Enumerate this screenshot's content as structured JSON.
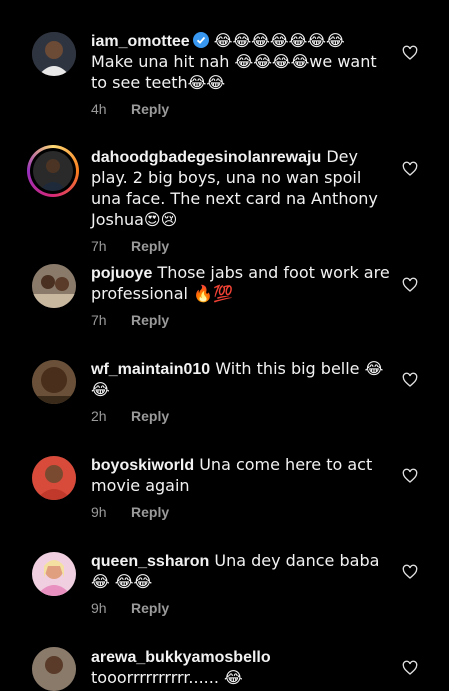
{
  "comments": [
    {
      "user": "iam_omottee",
      "verified": true,
      "text": " 😂😂😂😂😂😂😂 Make una hit nah 😂😂😂😂we want to see teeth😂😂",
      "time": "4h",
      "reply": "Reply",
      "avatar_color": "#4a4a4a"
    },
    {
      "user": "dahoodgbadegesinolanrewaju",
      "verified": false,
      "text": " Dey play. 2 big boys, una no wan spoil una face. The next card na Anthony Joshua😍😢",
      "time": "7h",
      "reply": "Reply",
      "avatar_color": "#3c3c3c"
    },
    {
      "user": "pojuoye",
      "verified": false,
      "text": " Those  jabs and foot work are professional 🔥💯",
      "time": "7h",
      "reply": "Reply",
      "avatar_color": "#6b5a4a"
    },
    {
      "user": "wf_maintain010",
      "verified": false,
      "text": " With this big belle 😂 😂",
      "time": "2h",
      "reply": "Reply",
      "avatar_color": "#5a3e2a"
    },
    {
      "user": "boyoskiworld",
      "verified": false,
      "text": " Una come here to act movie again",
      "time": "9h",
      "reply": "Reply",
      "avatar_color": "#c0392b"
    },
    {
      "user": "queen_ssharon",
      "verified": false,
      "text": " Una dey dance baba😂 😂😂",
      "time": "9h",
      "reply": "Reply",
      "avatar_color": "#e8a0c8"
    },
    {
      "user": "arewa_bukkyamosbello",
      "verified": false,
      "text": " tooorrrrrrrrrr...... 😂",
      "time": "",
      "reply": "",
      "avatar_color": "#7a6a5a"
    }
  ],
  "icons": {
    "like": "heart-outline-icon",
    "verified": "verified-badge-icon"
  }
}
